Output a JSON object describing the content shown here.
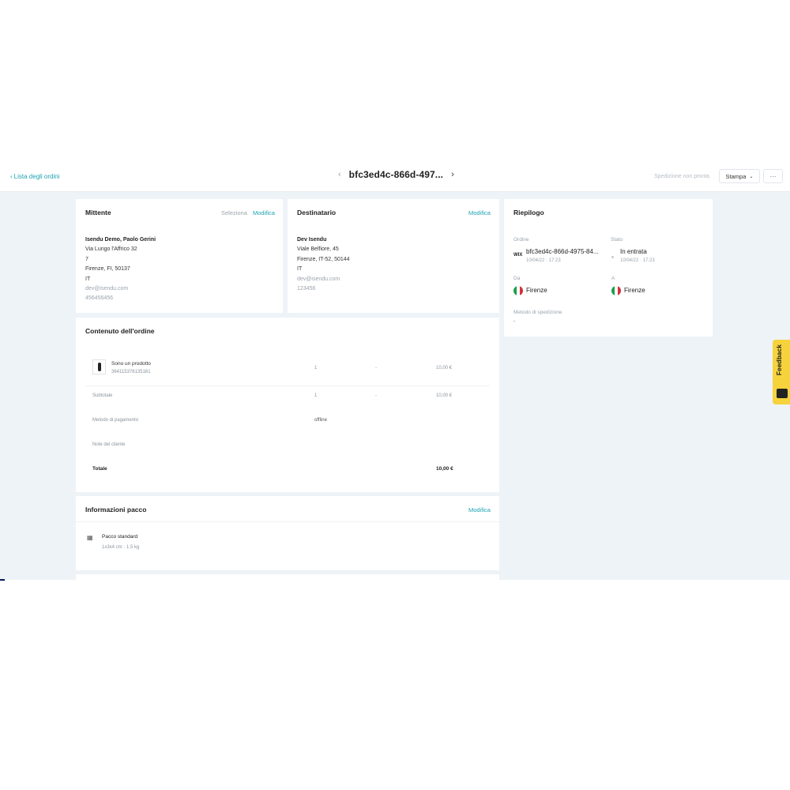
{
  "header": {
    "back_label": "Lista degli ordini",
    "order_id": "bfc3ed4c-866d-497...",
    "shipment_status": "Spedizione non pronta",
    "print_label": "Stampa",
    "more_label": "···"
  },
  "sender": {
    "title": "Mittente",
    "select_label": "Seleziona",
    "edit_label": "Modifica",
    "name": "Isendu Demo, Paolo Gerini",
    "street": "Via Lungo l'Affrico 32",
    "number": "7",
    "city": "Firenze, FI, 50137",
    "country": "IT",
    "email": "dev@isendu.com",
    "phone": "456456456"
  },
  "recipient": {
    "title": "Destinatario",
    "edit_label": "Modifica",
    "name": "Dev Isendu",
    "street": "Viale Belfiore, 45",
    "city": "Firenze, IT-52, 50144",
    "country": "IT",
    "email": "dev@isendu.com",
    "phone": "123456"
  },
  "summary": {
    "title": "Riepilogo",
    "order_label": "Ordine",
    "order_source": "WIX",
    "order_value": "bfc3ed4c-866d-4975-84...",
    "order_date": "10/04/22 · 17:23",
    "status_label": "Stato",
    "status_value": "In entrata",
    "status_date": "10/04/22 · 17:23",
    "from_label": "Da",
    "from_city": "Firenze",
    "to_label": "A",
    "to_city": "Firenze",
    "shipping_method_label": "Metodo di spedizione",
    "shipping_method_value": "-"
  },
  "order_content": {
    "title": "Contenuto dell'ordine",
    "product_name": "Sono un prodotto",
    "product_sku": "364115376135161",
    "product_qty": "1",
    "product_discount": "-",
    "product_price": "10,00 €",
    "subtotal_label": "Subtotale",
    "subtotal_qty": "1",
    "subtotal_dash": "-",
    "subtotal_value": "10,00 €",
    "payment_label": "Metodo di pagamento",
    "payment_value": "offline",
    "notes_label": "Note del cliente",
    "total_label": "Totale",
    "total_value": "10,00 €"
  },
  "package": {
    "title": "Informazioni pacco",
    "edit_label": "Modifica",
    "name": "Pacco standard",
    "details": "1x3x4 cm · 1.5 kg"
  },
  "feedback": {
    "label": "Feedback"
  },
  "colors": {
    "accent": "#1ea3b4",
    "background": "#eef3f7",
    "feedback": "#f6d33c"
  }
}
